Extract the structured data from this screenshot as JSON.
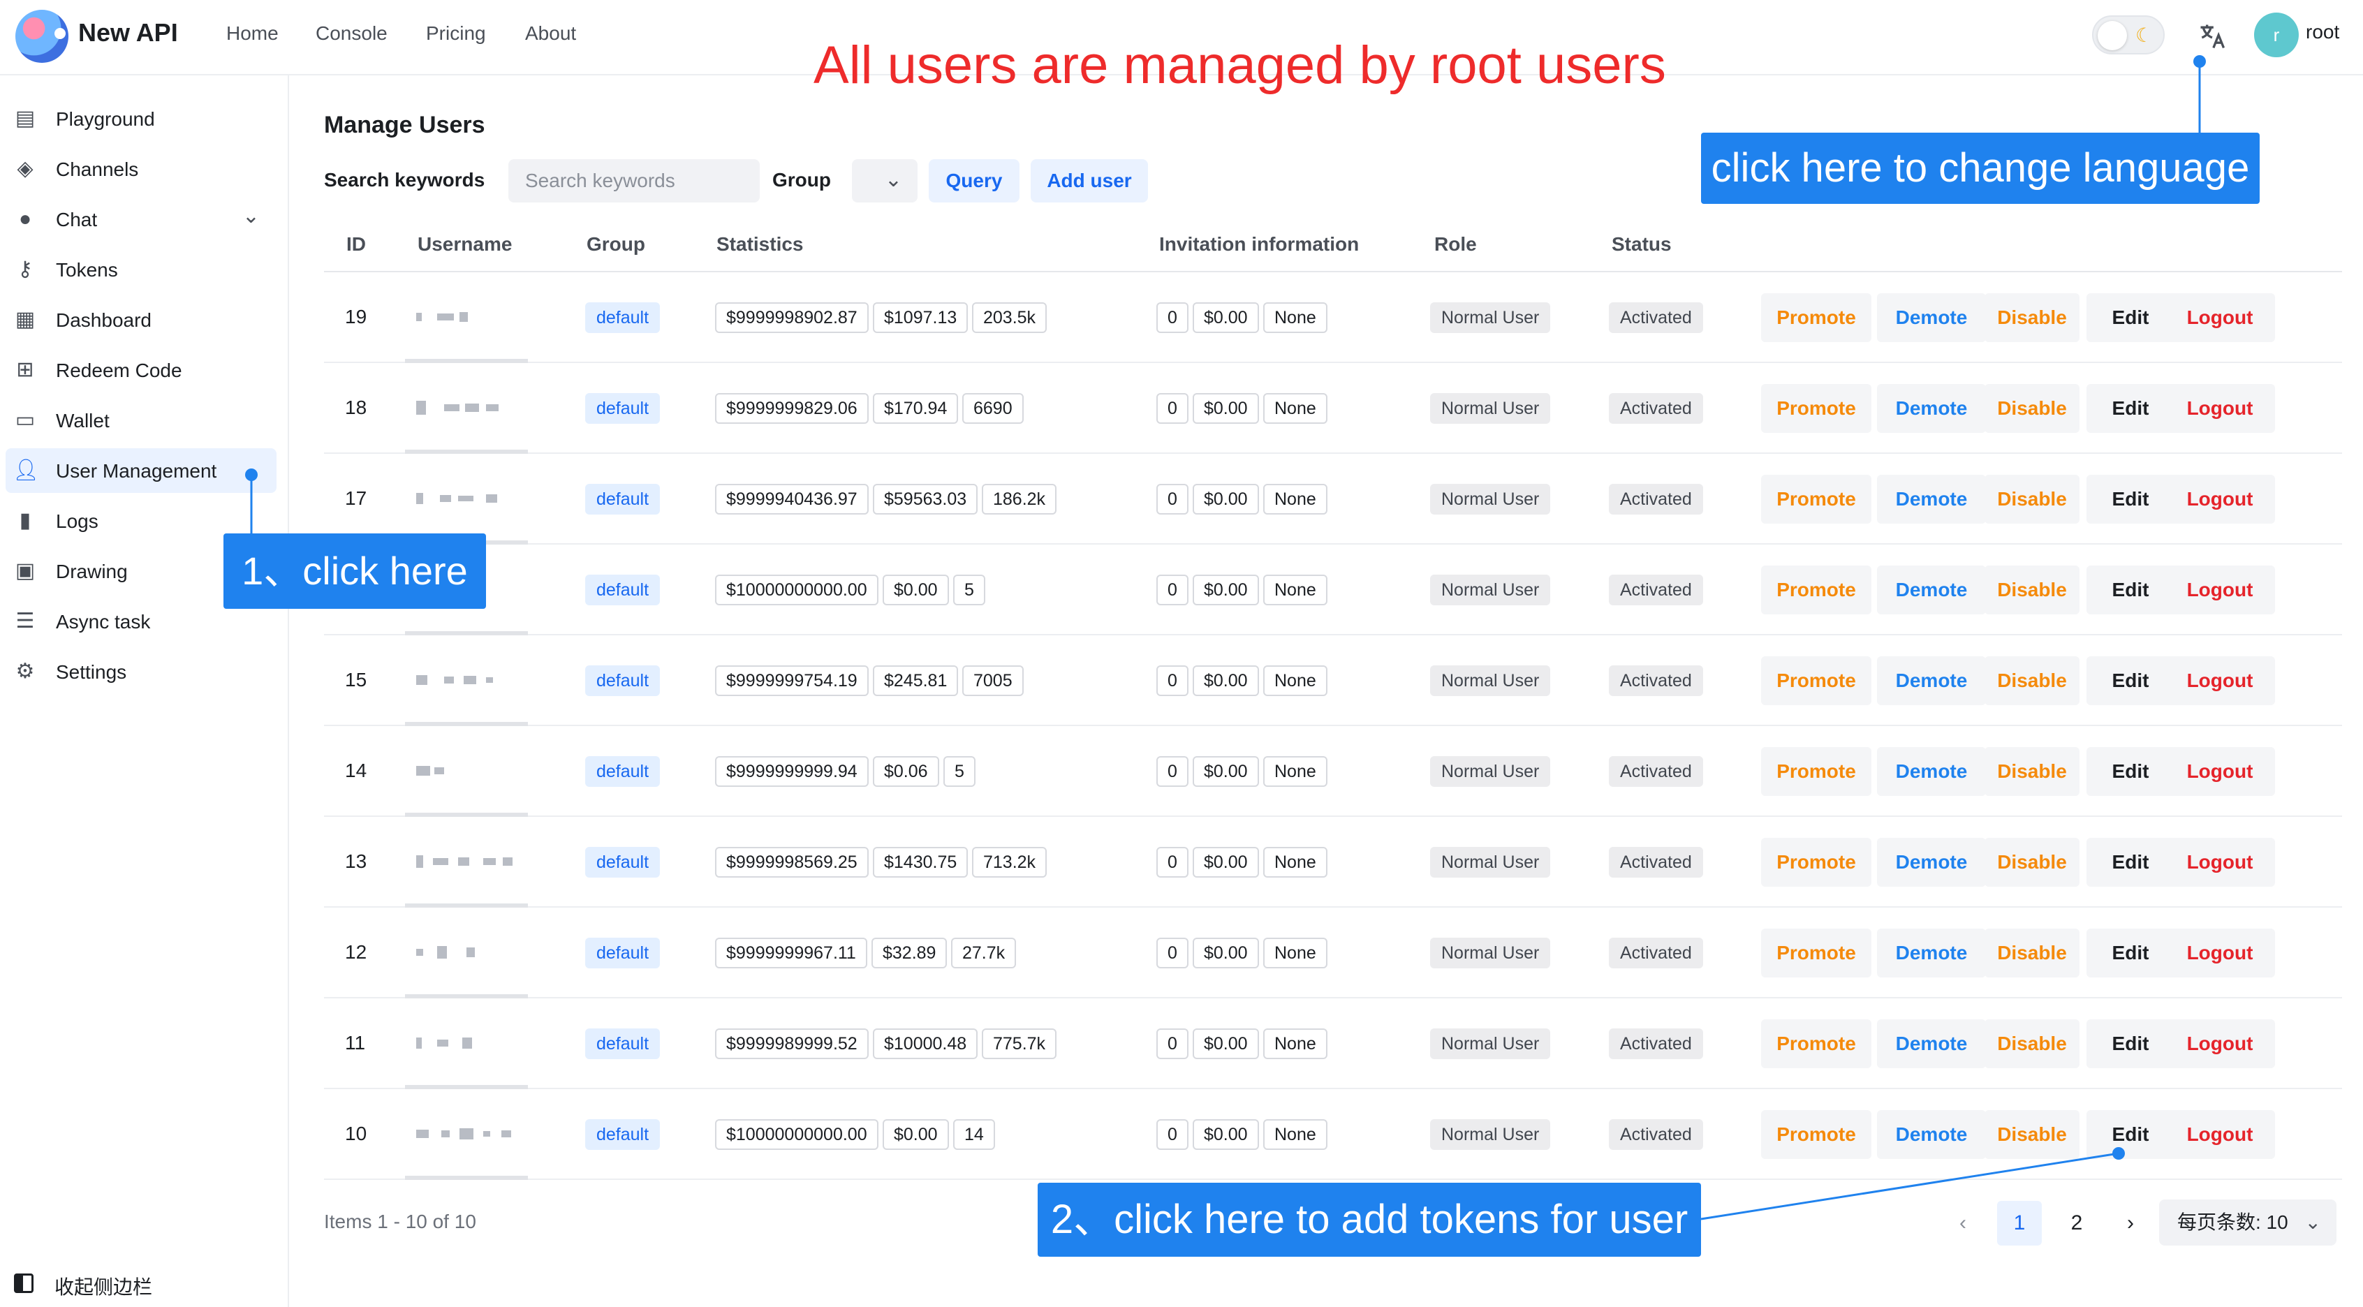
{
  "header": {
    "brand": "New API",
    "nav": [
      "Home",
      "Console",
      "Pricing",
      "About"
    ],
    "user": {
      "avatar_letter": "r",
      "name": "root"
    }
  },
  "sidebar": {
    "items": [
      {
        "label": "Playground",
        "icon": "playground-icon"
      },
      {
        "label": "Channels",
        "icon": "layers-icon"
      },
      {
        "label": "Chat",
        "icon": "chat-icon"
      },
      {
        "label": "Tokens",
        "icon": "key-icon"
      },
      {
        "label": "Dashboard",
        "icon": "dashboard-icon"
      },
      {
        "label": "Redeem Code",
        "icon": "gift-icon"
      },
      {
        "label": "Wallet",
        "icon": "wallet-icon"
      },
      {
        "label": "User Management",
        "icon": "user-icon",
        "active": true
      },
      {
        "label": "Logs",
        "icon": "bar-chart-icon"
      },
      {
        "label": "Drawing",
        "icon": "image-icon"
      },
      {
        "label": "Async task",
        "icon": "checklist-icon"
      },
      {
        "label": "Settings",
        "icon": "gear-icon"
      }
    ],
    "collapse_label": "收起侧边栏"
  },
  "main": {
    "title": "Manage Users",
    "search_label": "Search keywords",
    "search_placeholder": "Search keywords",
    "group_label": "Group",
    "query_button": "Query",
    "add_user_button": "Add user",
    "columns": [
      "ID",
      "Username",
      "Group",
      "Statistics",
      "Invitation information",
      "Role",
      "Status"
    ],
    "rows": [
      {
        "id": "19",
        "group": "default",
        "stats": [
          "$9999998902.87",
          "$1097.13",
          "203.5k"
        ],
        "invite": [
          "0",
          "$0.00",
          "None"
        ],
        "role": "Normal User",
        "status": "Activated"
      },
      {
        "id": "18",
        "group": "default",
        "stats": [
          "$9999999829.06",
          "$170.94",
          "6690"
        ],
        "invite": [
          "0",
          "$0.00",
          "None"
        ],
        "role": "Normal User",
        "status": "Activated"
      },
      {
        "id": "17",
        "group": "default",
        "stats": [
          "$9999940436.97",
          "$59563.03",
          "186.2k"
        ],
        "invite": [
          "0",
          "$0.00",
          "None"
        ],
        "role": "Normal User",
        "status": "Activated"
      },
      {
        "id": "",
        "group": "default",
        "stats": [
          "$10000000000.00",
          "$0.00",
          "5"
        ],
        "invite": [
          "0",
          "$0.00",
          "None"
        ],
        "role": "Normal User",
        "status": "Activated"
      },
      {
        "id": "15",
        "group": "default",
        "stats": [
          "$9999999754.19",
          "$245.81",
          "7005"
        ],
        "invite": [
          "0",
          "$0.00",
          "None"
        ],
        "role": "Normal User",
        "status": "Activated"
      },
      {
        "id": "14",
        "group": "default",
        "stats": [
          "$9999999999.94",
          "$0.06",
          "5"
        ],
        "invite": [
          "0",
          "$0.00",
          "None"
        ],
        "role": "Normal User",
        "status": "Activated"
      },
      {
        "id": "13",
        "group": "default",
        "stats": [
          "$9999998569.25",
          "$1430.75",
          "713.2k"
        ],
        "invite": [
          "0",
          "$0.00",
          "None"
        ],
        "role": "Normal User",
        "status": "Activated"
      },
      {
        "id": "12",
        "group": "default",
        "stats": [
          "$9999999967.11",
          "$32.89",
          "27.7k"
        ],
        "invite": [
          "0",
          "$0.00",
          "None"
        ],
        "role": "Normal User",
        "status": "Activated"
      },
      {
        "id": "11",
        "group": "default",
        "stats": [
          "$9999989999.52",
          "$10000.48",
          "775.7k"
        ],
        "invite": [
          "0",
          "$0.00",
          "None"
        ],
        "role": "Normal User",
        "status": "Activated"
      },
      {
        "id": "10",
        "group": "default",
        "stats": [
          "$10000000000.00",
          "$0.00",
          "14"
        ],
        "invite": [
          "0",
          "$0.00",
          "None"
        ],
        "role": "Normal User",
        "status": "Activated"
      }
    ],
    "actions": [
      {
        "label": "Promote",
        "color": "#f58a0b"
      },
      {
        "label": "Demote",
        "color": "#1f82ee"
      },
      {
        "label": "Disable",
        "color": "#f58a0b"
      },
      {
        "label": "Edit",
        "color": "#1c1f23"
      },
      {
        "label": "Logout",
        "color": "#e5242b"
      }
    ],
    "items_text": "Items 1 - 10 of 10",
    "pagination": {
      "pages": [
        "1",
        "2"
      ],
      "current": "1",
      "page_size_label": "每页条数: 10"
    }
  },
  "annotations": {
    "title": "All users are managed by root users",
    "lang_hint": "click here to change language",
    "step1": "1、click here",
    "step2": "2、click here to add tokens for user"
  }
}
